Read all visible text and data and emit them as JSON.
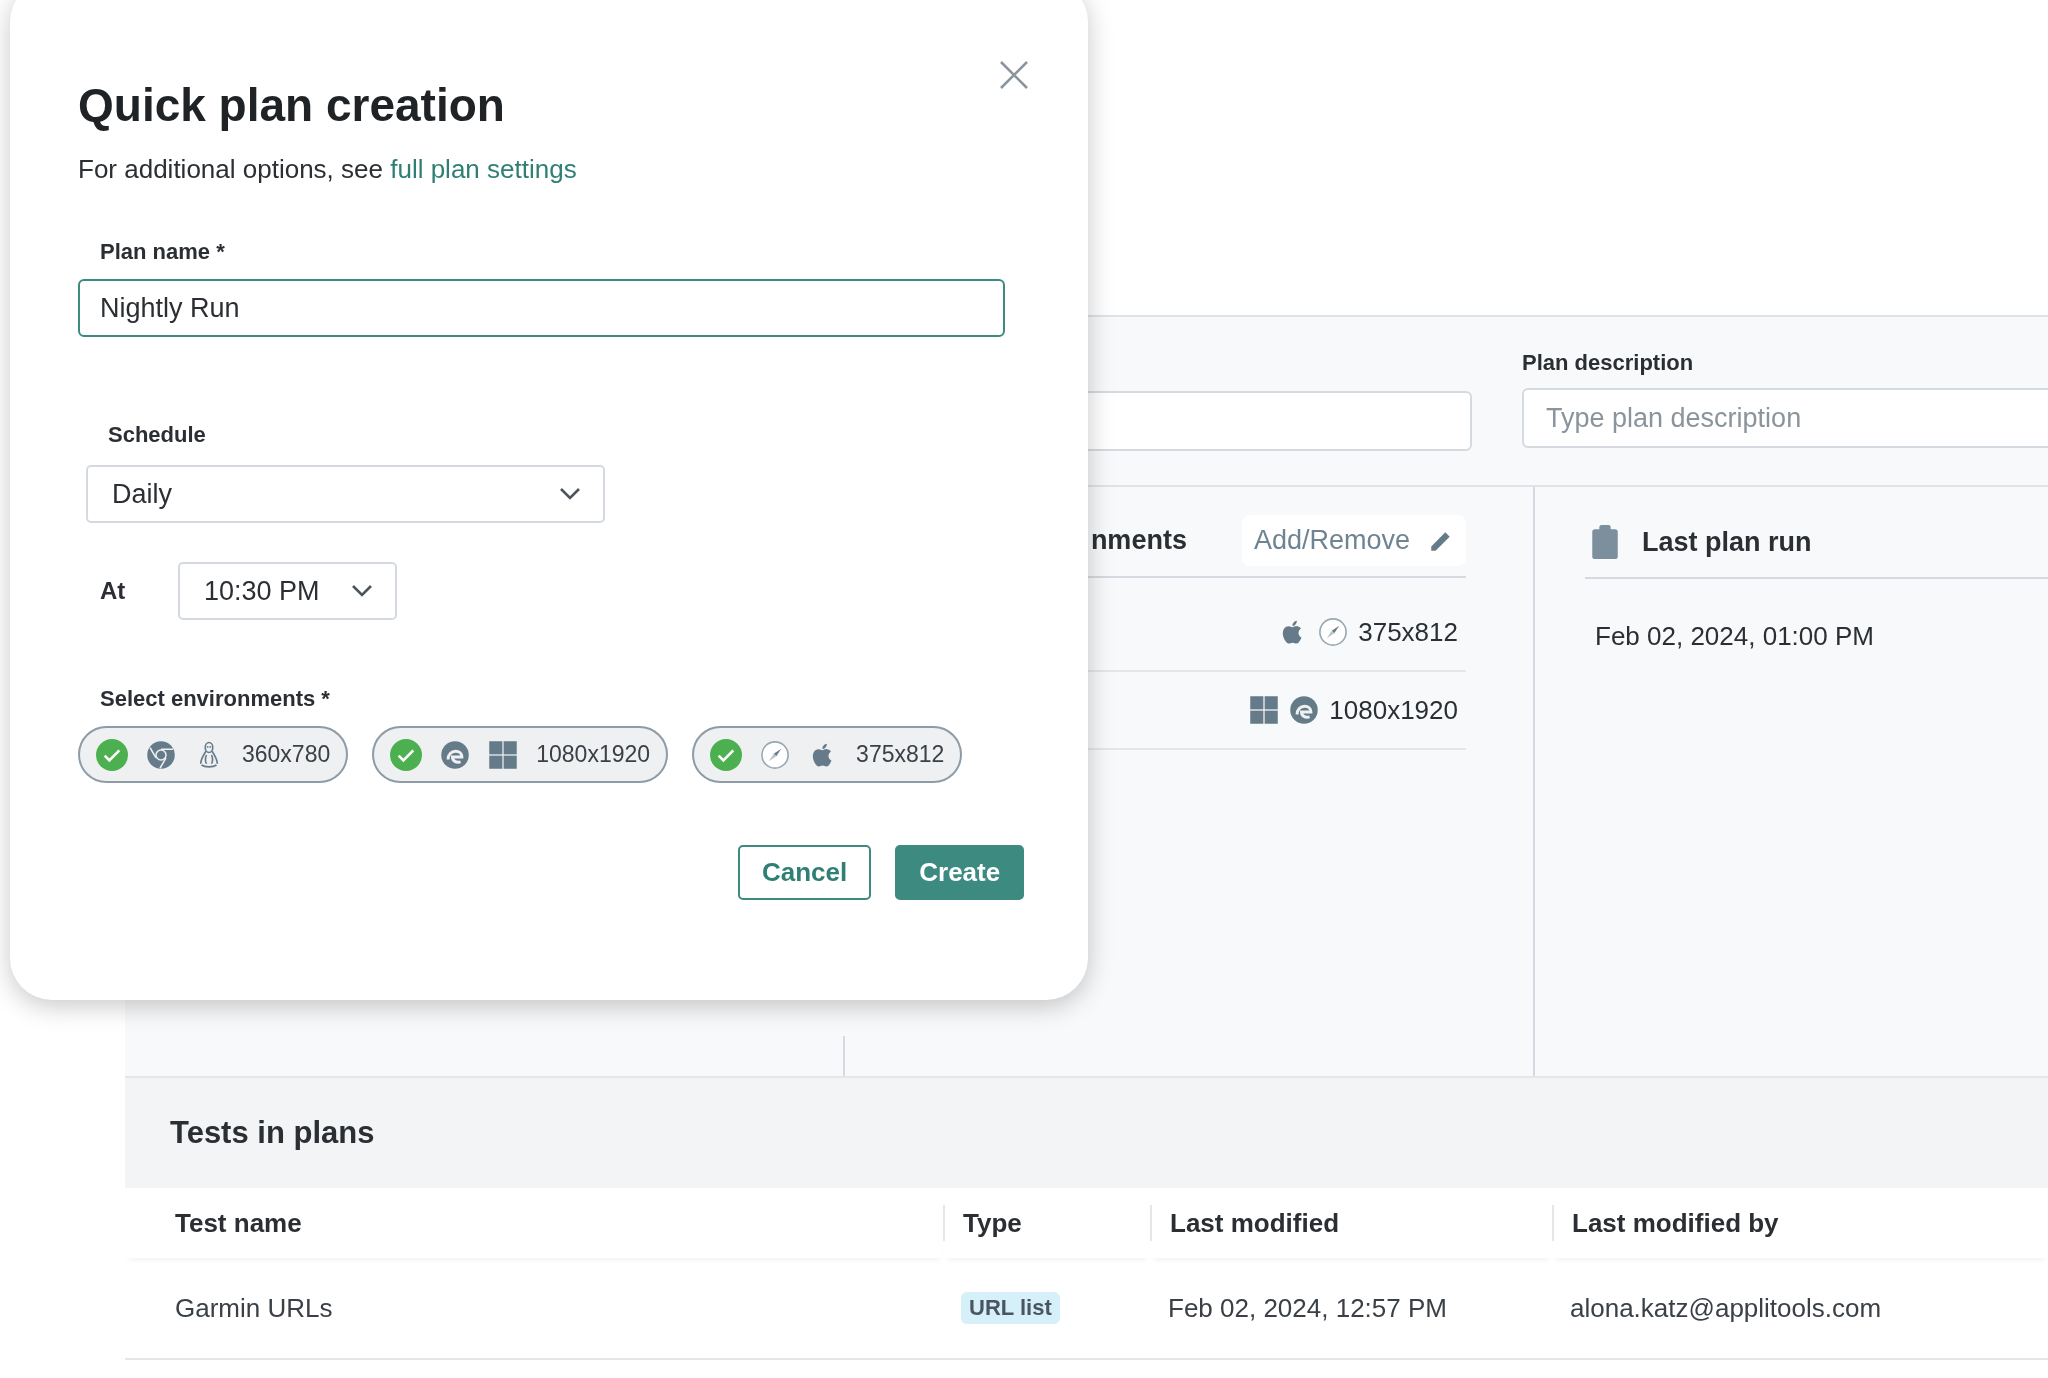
{
  "dialog": {
    "title": "Quick plan creation",
    "subtitle": "For additional options, see",
    "subtitle_link": "full plan settings",
    "plan_name": {
      "label": "Plan name *",
      "value": "Nightly Run"
    },
    "schedule": {
      "label": "Schedule",
      "value": "Daily"
    },
    "time": {
      "label": "At",
      "value": "10:30 PM"
    },
    "environments": {
      "label": "Select environments *",
      "items": [
        {
          "icons": [
            {
              "kind": "chrome"
            },
            {
              "kind": "linux"
            }
          ],
          "resolution": "360x780",
          "checked": true
        },
        {
          "icons": [
            {
              "kind": "edge"
            },
            {
              "kind": "windows"
            }
          ],
          "resolution": "1080x1920",
          "checked": true
        },
        {
          "icons": [
            {
              "kind": "safari"
            },
            {
              "kind": "apple"
            }
          ],
          "resolution": "375x812",
          "checked": true
        }
      ]
    },
    "buttons": [
      {
        "label": "Cancel",
        "kind": "secondary"
      },
      {
        "label": "Create",
        "kind": "primary"
      }
    ]
  },
  "background": {
    "description": {
      "label": "Plan description",
      "placeholder": "Type plan description"
    },
    "environments": {
      "heading": "nments",
      "action": "Add/Remove",
      "items": [
        {
          "icons": [
            {
              "kind": "apple"
            },
            {
              "kind": "safari"
            }
          ],
          "resolution": "375x812"
        },
        {
          "icons": [
            {
              "kind": "windows"
            },
            {
              "kind": "edge"
            }
          ],
          "resolution": "1080x1920"
        }
      ]
    },
    "last_run": {
      "heading": "Last plan run",
      "value": "Feb 02, 2024, 01:00 PM"
    }
  },
  "tests": {
    "title": "Tests in plans",
    "columns": [
      "Test name",
      "Type",
      "Last modified",
      "Last modified by"
    ],
    "rows": [
      {
        "test_name": "Garmin URLs",
        "type": "URL list",
        "last_modified": "Feb 02, 2024, 12:57 PM",
        "last_modified_by": "alona.katz@applitools.com"
      }
    ]
  }
}
